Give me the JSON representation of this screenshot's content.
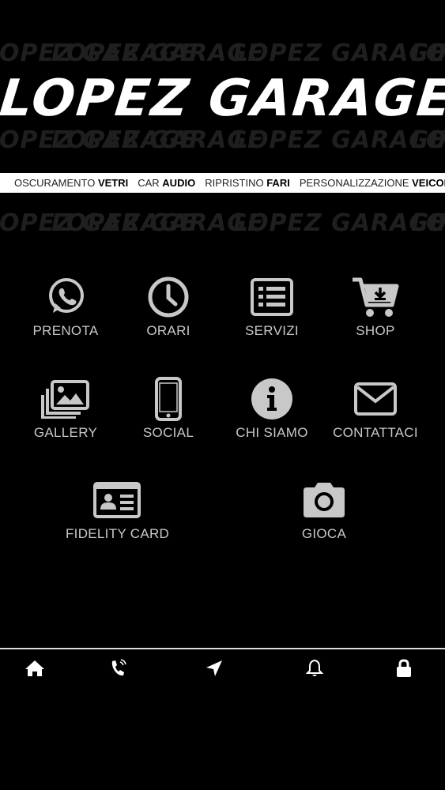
{
  "header": {
    "logo_text": "LOPEZ GARAGE",
    "watermark_text": "LOPEZ GARAGE",
    "tagline": [
      {
        "light": "OSCURAMENTO ",
        "bold": "VETRI"
      },
      {
        "light": "CAR ",
        "bold": "AUDIO"
      },
      {
        "light": "RIPRISTINO ",
        "bold": "FARI"
      },
      {
        "light": "PERSONALIZZAZIONE ",
        "bold": "VEICOLI"
      }
    ]
  },
  "menu": {
    "items": [
      {
        "label": "PRENOTA",
        "icon": "whatsapp-icon"
      },
      {
        "label": "ORARI",
        "icon": "clock-icon"
      },
      {
        "label": "SERVIZI",
        "icon": "list-icon"
      },
      {
        "label": "SHOP",
        "icon": "cart-download-icon"
      },
      {
        "label": "GALLERY",
        "icon": "images-icon"
      },
      {
        "label": "SOCIAL",
        "icon": "smartphone-icon"
      },
      {
        "label": "CHI SIAMO",
        "icon": "info-icon"
      },
      {
        "label": "CONTATTACI",
        "icon": "envelope-icon"
      },
      {
        "label": "FIDELITY CARD",
        "icon": "id-card-icon"
      },
      {
        "label": "GIOCA",
        "icon": "camera-icon"
      }
    ]
  },
  "tabbar": {
    "items": [
      "home-icon",
      "phone-ring-icon",
      "location-arrow-icon",
      "bell-icon",
      "lock-icon"
    ]
  },
  "colors": {
    "background": "#000000",
    "icon": "#c8c8c8",
    "tagline_bg": "#ffffff"
  }
}
